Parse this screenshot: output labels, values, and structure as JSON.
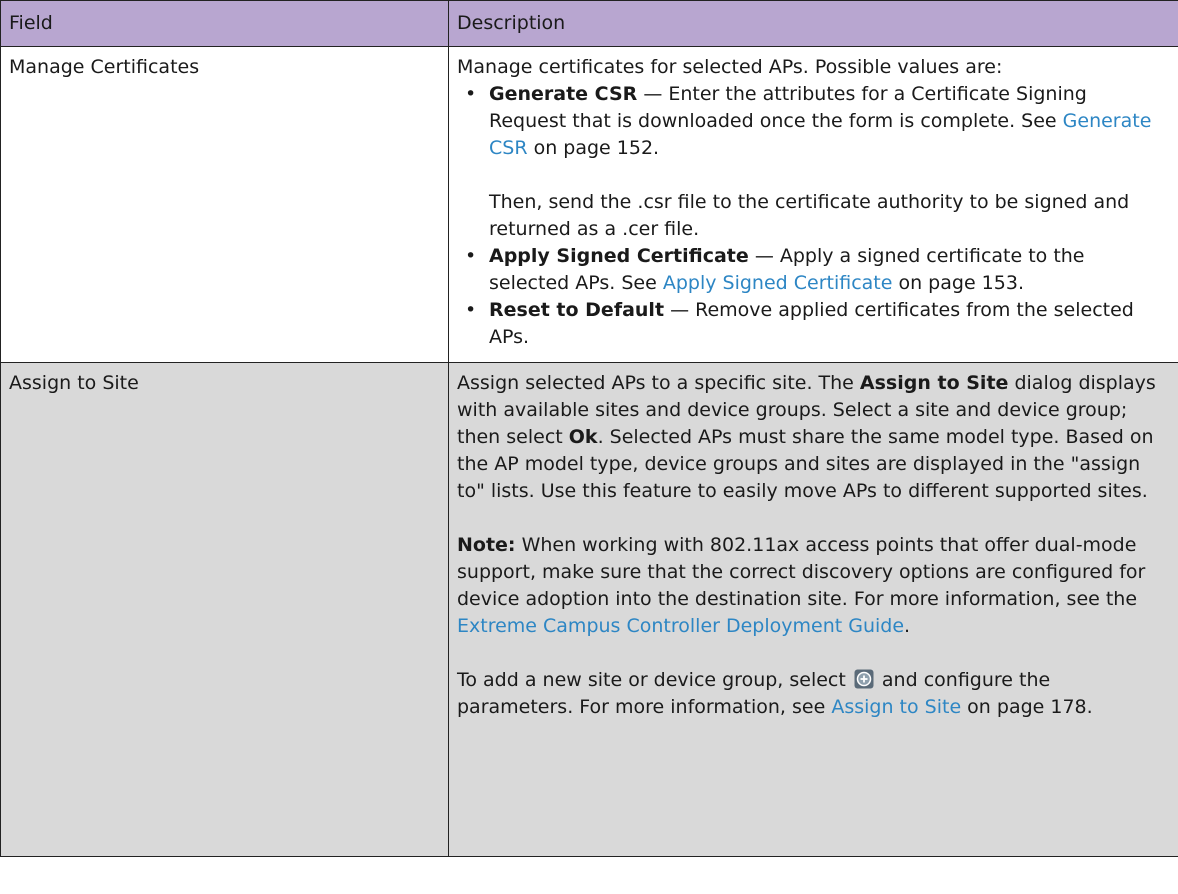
{
  "header": {
    "field": "Field",
    "description": "Description"
  },
  "row1": {
    "field": "Manage Certificates",
    "intro": "Manage certificates for selected APs. Possible values are:",
    "items": [
      {
        "term": "Generate CSR",
        "text": " — Enter the attributes for a Certificate Signing Request that is downloaded once the form is complete. See ",
        "link": "Generate CSR",
        "after": " on page 152."
      },
      {
        "term": "Apply Signed Certificate",
        "text": " — Apply a signed certificate to the selected APs. See ",
        "link": "Apply Signed Certificate",
        "after": " on page 153."
      },
      {
        "term": "Reset to Default",
        "text": " — Remove applied certificates from the selected APs."
      }
    ],
    "continuation": "Then, send the .csr file to the certificate authority to be signed and returned as a .cer file."
  },
  "row2": {
    "field": "Assign to Site",
    "p1_a": "Assign selected APs to a specific site. The ",
    "p1_b": "Assign to Site",
    "p1_c": " dialog displays with available sites and device groups. Select a site and device group; then select ",
    "p1_d": "Ok",
    "p1_e": ". Selected APs must share the same model type. Based on the AP model type, device groups and sites are displayed in the \"assign to\" lists. Use this feature to easily move APs to different supported sites.",
    "note_label": "Note:",
    "note_text": " When working with 802.11ax access points that offer dual-mode support, make sure that the correct discovery options are configured for device adoption into the destination site. For more information, see the ",
    "note_link": "Extreme Campus Controller Deployment Guide",
    "note_end": ".",
    "p3_a": "To add a new site or device group, select ",
    "p3_b": " and configure the parameters. For more information, see ",
    "p3_link": "Assign to Site",
    "p3_c": " on page 178."
  },
  "colors": {
    "header_bg": "#b8a6d0",
    "grey_row_bg": "#d9d9d9",
    "link": "#2d86c4"
  }
}
